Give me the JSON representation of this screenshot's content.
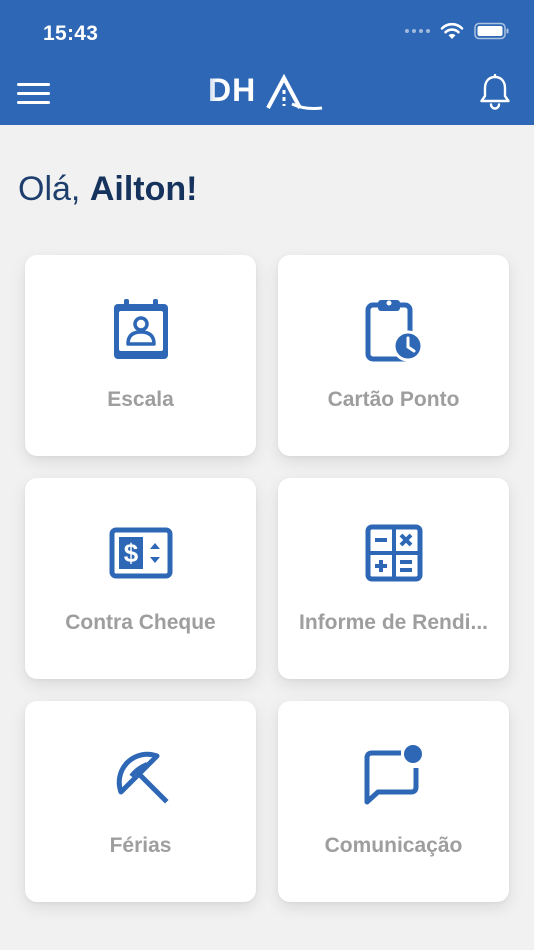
{
  "status_bar": {
    "time": "15:43"
  },
  "header": {
    "logo_text": "DHO",
    "menu_icon": "hamburger-menu-icon",
    "notification_icon": "bell-icon"
  },
  "greeting": {
    "prefix": "Olá, ",
    "name": "Ailton!"
  },
  "colors": {
    "primary": "#2d67b5",
    "heading": "#1e3f6e",
    "card_label": "#9e9e9e",
    "background": "#f1f1f1"
  },
  "menu": [
    {
      "label": "Escala",
      "icon": "badge-calendar-icon"
    },
    {
      "label": "Cartão Ponto",
      "icon": "clipboard-clock-icon"
    },
    {
      "label": "Contra Cheque",
      "icon": "money-bill-icon"
    },
    {
      "label": "Informe de Rendi...",
      "icon": "calculator-icon"
    },
    {
      "label": "Férias",
      "icon": "beach-umbrella-icon"
    },
    {
      "label": "Comunicação",
      "icon": "message-notification-icon"
    }
  ]
}
